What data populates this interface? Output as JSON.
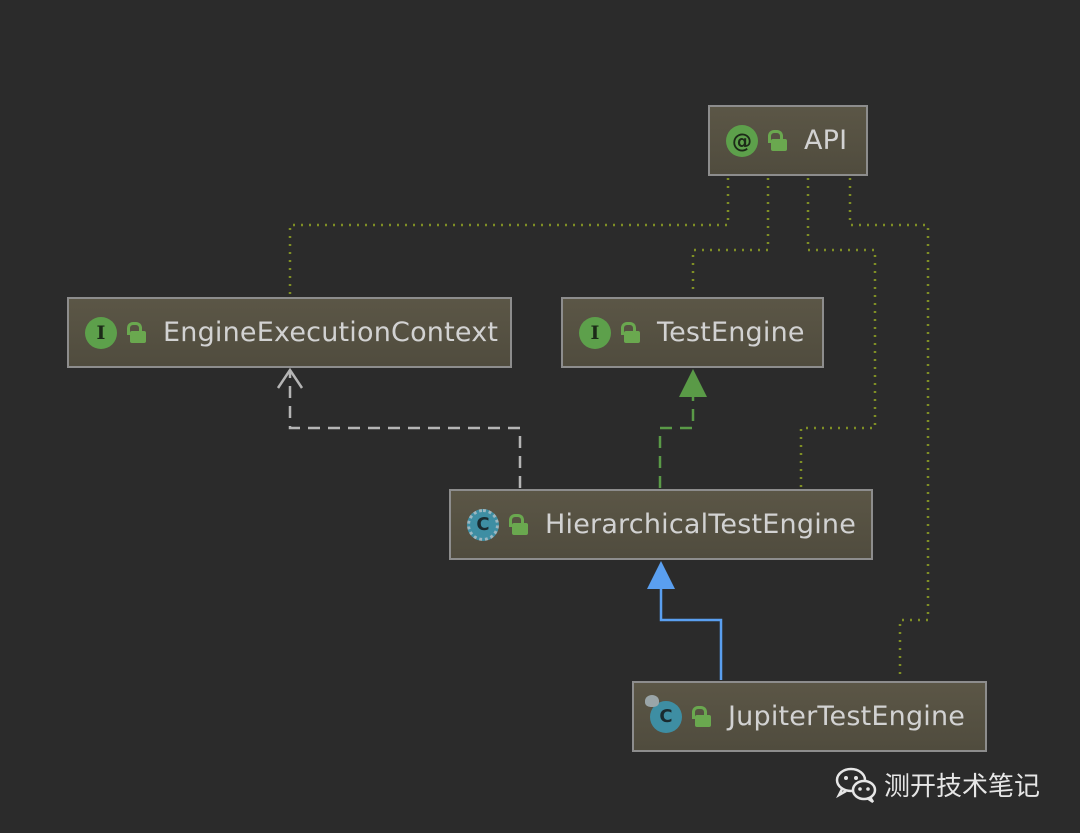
{
  "nodes": {
    "api": {
      "label": "API",
      "kind": "annotation",
      "badge": "@",
      "icon": "annotation-icon"
    },
    "engine_execution_context": {
      "label": "EngineExecutionContext",
      "kind": "interface",
      "badge": "I",
      "icon": "interface-icon"
    },
    "test_engine": {
      "label": "TestEngine",
      "kind": "interface",
      "badge": "I",
      "icon": "interface-icon"
    },
    "hierarchical_test_engine": {
      "label": "HierarchicalTestEngine",
      "kind": "abstract-class",
      "badge": "C",
      "icon": "abstract-class-icon"
    },
    "jupiter_test_engine": {
      "label": "JupiterTestEngine",
      "kind": "class",
      "badge": "C",
      "icon": "class-icon"
    }
  },
  "edges": [
    {
      "from": "hierarchical_test_engine",
      "to": "engine_execution_context",
      "type": "dependency",
      "style": "dashed",
      "color": "#b5b5b5"
    },
    {
      "from": "hierarchical_test_engine",
      "to": "test_engine",
      "type": "implements",
      "style": "dashed",
      "color": "#5a9a47"
    },
    {
      "from": "jupiter_test_engine",
      "to": "hierarchical_test_engine",
      "type": "extends",
      "style": "solid",
      "color": "#5a9ff0"
    },
    {
      "from": "engine_execution_context",
      "to": "api",
      "type": "annotated-by",
      "style": "dotted",
      "color": "#7f8f25"
    },
    {
      "from": "test_engine",
      "to": "api",
      "type": "annotated-by",
      "style": "dotted",
      "color": "#7f8f25"
    },
    {
      "from": "hierarchical_test_engine",
      "to": "api",
      "type": "annotated-by",
      "style": "dotted",
      "color": "#7f8f25"
    },
    {
      "from": "jupiter_test_engine",
      "to": "api",
      "type": "annotated-by",
      "style": "dotted",
      "color": "#7f8f25"
    }
  ],
  "watermark": {
    "text": "测开技术笔记",
    "icon": "wechat-icon"
  },
  "colors": {
    "background": "#2b2b2b",
    "node_fill": "#554f40",
    "node_border": "#8d8d8d",
    "node_text": "#d2d2d2",
    "visibility_icon": "#6aa84f"
  }
}
